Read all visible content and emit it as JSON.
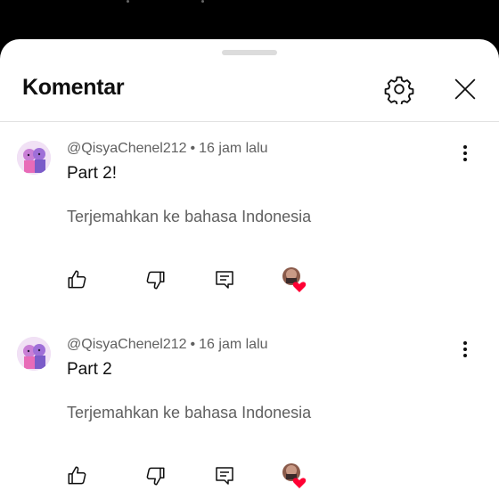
{
  "header": {
    "title": "Komentar"
  },
  "comments": [
    {
      "author": "@QisyaChenel212",
      "separator": "•",
      "time": "16 jam lalu",
      "text": "Part 2!",
      "translate_label": "Terjemahkan ke bahasa Indonesia"
    },
    {
      "author": "@QisyaChenel212",
      "separator": "•",
      "time": "16 jam lalu",
      "text": "Part 2",
      "translate_label": "Terjemahkan ke bahasa Indonesia"
    }
  ],
  "icons": {
    "settings": "gear-icon",
    "close": "close-icon",
    "more": "more-vert-icon",
    "like": "thumbs-up-icon",
    "dislike": "thumbs-down-icon",
    "reply": "reply-icon",
    "creator_heart": "heart-icon"
  },
  "colors": {
    "heart": "#ff0033",
    "text_primary": "#0f0f0f",
    "text_secondary": "#606060"
  }
}
